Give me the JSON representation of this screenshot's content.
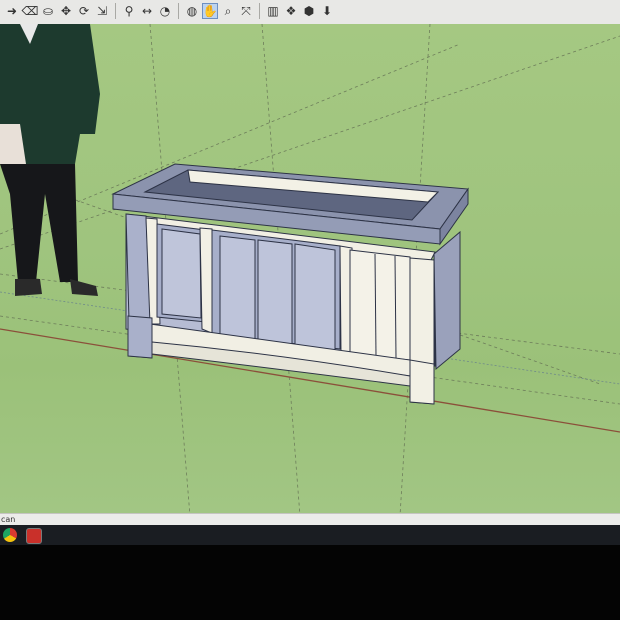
{
  "toolbar": {
    "groups": [
      [
        "select-arrow-icon",
        "eraser-icon",
        "paint-bucket-icon",
        "move-icon",
        "rotate-icon",
        "scale-icon"
      ],
      [
        "tape-measure-icon",
        "dimension-icon",
        "protractor-icon"
      ],
      [
        "orbit-icon",
        "pan-icon",
        "zoom-icon",
        "zoom-extents-icon"
      ],
      [
        "sections-icon",
        "components-icon",
        "materials-icon",
        "get-models-icon"
      ]
    ],
    "active_tool": "pan-icon"
  },
  "viewport": {
    "background_color": "#a0c57f",
    "model": "planter box",
    "scale_figure": "person"
  },
  "statusbar": {
    "text": "can"
  },
  "taskbar": {
    "apps": [
      "chrome-icon",
      "sketchup-icon"
    ]
  }
}
